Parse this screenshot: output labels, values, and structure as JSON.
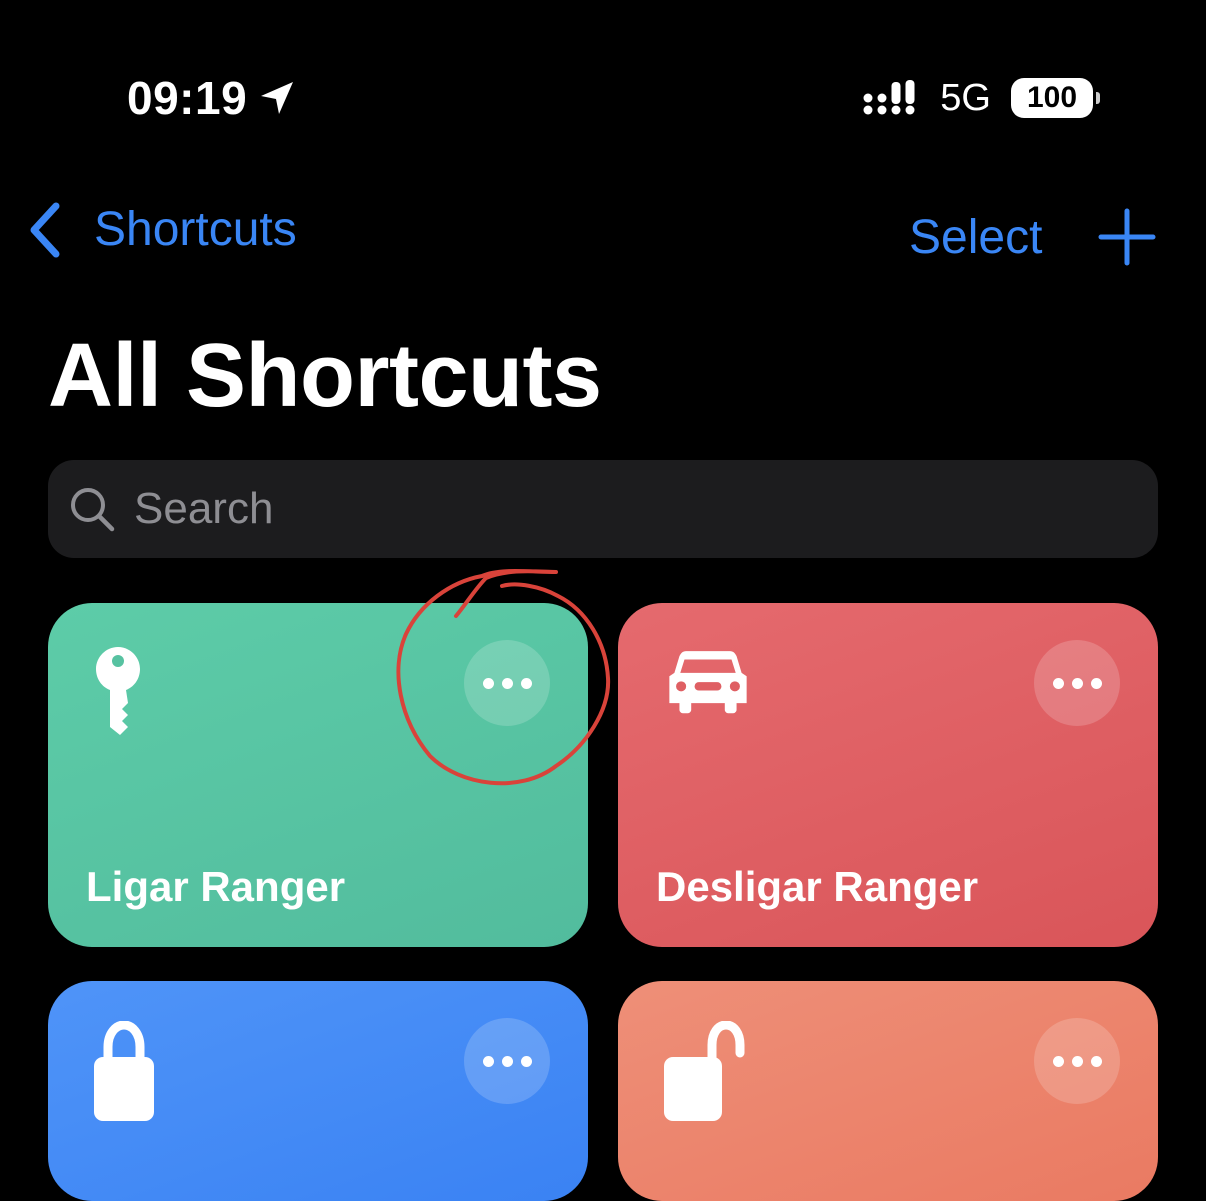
{
  "status_bar": {
    "time": "09:19",
    "network": "5G",
    "battery": "100"
  },
  "nav": {
    "back_label": "Shortcuts",
    "select_label": "Select"
  },
  "page_title": "All Shortcuts",
  "search": {
    "placeholder": "Search"
  },
  "shortcuts": [
    {
      "label": "Ligar Ranger",
      "icon": "key-icon",
      "color": "#57c2a1"
    },
    {
      "label": "Desligar Ranger",
      "icon": "car-icon",
      "color": "#df5f63"
    },
    {
      "label": "",
      "icon": "lock-icon",
      "color": "#438bf5"
    },
    {
      "label": "",
      "icon": "unlock-icon",
      "color": "#ec856c"
    }
  ],
  "colors": {
    "accent": "#3a86f5",
    "background": "#000000",
    "search_bg": "#1c1c1e",
    "annotation": "#d9433a"
  }
}
